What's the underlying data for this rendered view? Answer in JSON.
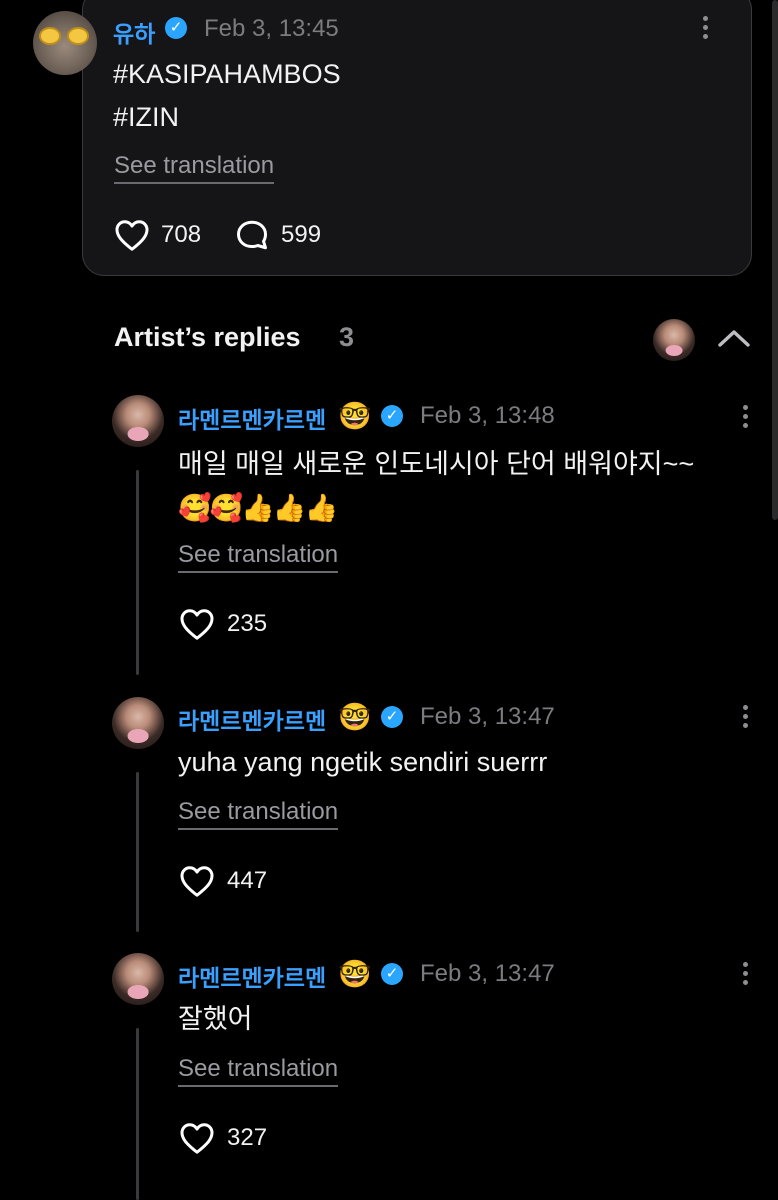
{
  "post": {
    "author": "유하",
    "time": "Feb 3, 13:45",
    "line1": "#KASIPAHAMBOS",
    "line2": "#IZIN",
    "see_translation": "See translation",
    "likes": "708",
    "comments": "599"
  },
  "replies_section": {
    "title": "Artist’s replies",
    "count": "3"
  },
  "replies": [
    {
      "author": "라멘르멘카르멘",
      "author_emoji": "🤓",
      "time": "Feb 3, 13:48",
      "text": "매일 매일 새로운 인도네시아 단어 배워야지~~",
      "emojis": "🥰🥰👍👍👍",
      "see_translation": "See translation",
      "likes": "235"
    },
    {
      "author": "라멘르멘카르멘",
      "author_emoji": "🤓",
      "time": "Feb 3, 13:47",
      "text": "yuha yang ngetik sendiri suerrr",
      "see_translation": "See translation",
      "likes": "447"
    },
    {
      "author": "라멘르멘카르멘",
      "author_emoji": "🤓",
      "time": "Feb 3, 13:47",
      "text": "잘했어",
      "see_translation": "See translation",
      "likes": "327"
    }
  ],
  "colors": {
    "accent": "#3aa0ff",
    "verified": "#2aa6ff",
    "background": "#000000",
    "card": "#151517"
  }
}
